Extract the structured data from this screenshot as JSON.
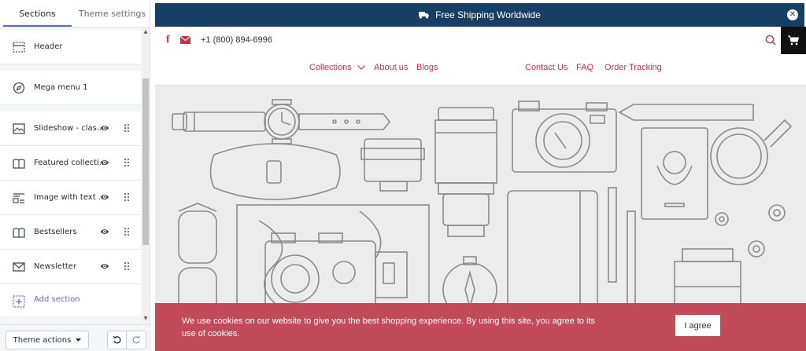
{
  "sidebar": {
    "tabs": [
      {
        "label": "Sections",
        "active": true
      },
      {
        "label": "Theme settings",
        "active": false
      }
    ],
    "sections": [
      {
        "label": "Header",
        "icon": "header-icon",
        "toggleable": false
      },
      {
        "label": "Mega menu 1",
        "icon": "compass-icon",
        "toggleable": false
      },
      {
        "label": "Slideshow - clas...",
        "icon": "slideshow-icon",
        "toggleable": true
      },
      {
        "label": "Featured collecti...",
        "icon": "collection-icon",
        "toggleable": true
      },
      {
        "label": "Image with text ...",
        "icon": "image-text-icon",
        "toggleable": true
      },
      {
        "label": "Bestsellers",
        "icon": "collection-icon",
        "toggleable": true
      },
      {
        "label": "Newsletter",
        "icon": "envelope-icon",
        "toggleable": true
      }
    ],
    "add_section_label": "Add section",
    "footer": {
      "theme_actions_label": "Theme actions"
    }
  },
  "preview": {
    "announcement": {
      "text": "Free Shipping Worldwide",
      "background": "#173f66"
    },
    "header": {
      "phone": "+1 (800) 894-6996",
      "accent": "#c8324c"
    },
    "nav": {
      "collections": "Collections",
      "about": "About us",
      "blogs": "Blogs",
      "contact": "Contact Us",
      "faq": "FAQ",
      "tracking": "Order Tracking"
    },
    "cookie": {
      "text": "We use cookies on our website to give you the best shopping experience. By using this site, you agree to its use of cookies.",
      "button": "I agree",
      "background": "#c14a5b"
    }
  }
}
